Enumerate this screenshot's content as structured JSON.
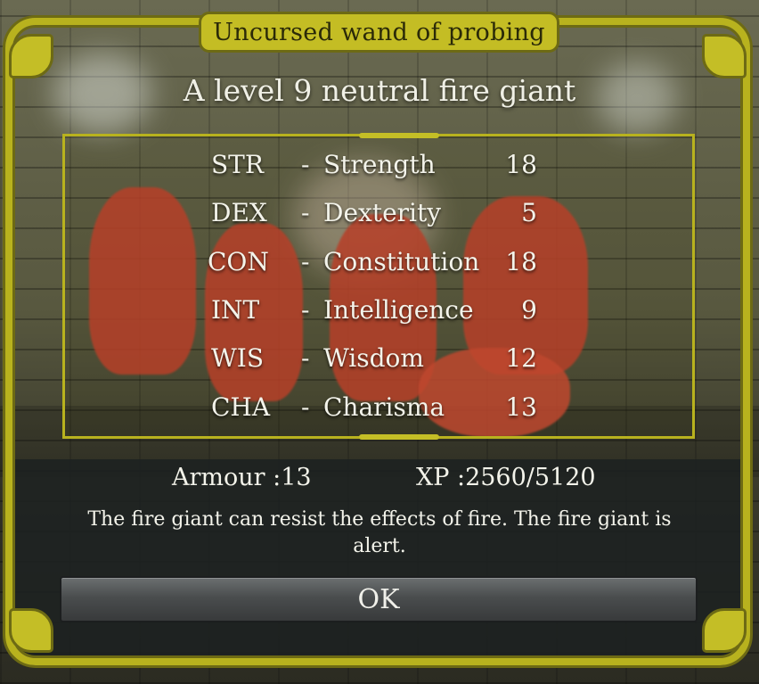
{
  "dialog": {
    "title": "Uncursed wand of probing",
    "monster": "A level 9 neutral fire giant"
  },
  "stats": [
    {
      "abbr": "STR",
      "dash": "-",
      "name": "Strength",
      "value": "18"
    },
    {
      "abbr": "DEX",
      "dash": "-",
      "name": "Dexterity",
      "value": "5"
    },
    {
      "abbr": "CON",
      "dash": "-",
      "name": "Constitution",
      "value": "18"
    },
    {
      "abbr": "INT",
      "dash": "-",
      "name": "Intelligence",
      "value": "9"
    },
    {
      "abbr": "WIS",
      "dash": "-",
      "name": "Wisdom",
      "value": "12"
    },
    {
      "abbr": "CHA",
      "dash": "-",
      "name": "Charisma",
      "value": "13"
    }
  ],
  "armour": "Armour :13",
  "xp": "XP :2560/5120",
  "description": "The fire giant can resist the effects of fire. The fire giant is alert.",
  "ok_label": "OK",
  "colors": {
    "frame_gold": "#b8b21e",
    "text": "#f3f3ea",
    "panel": "#1c2121"
  }
}
